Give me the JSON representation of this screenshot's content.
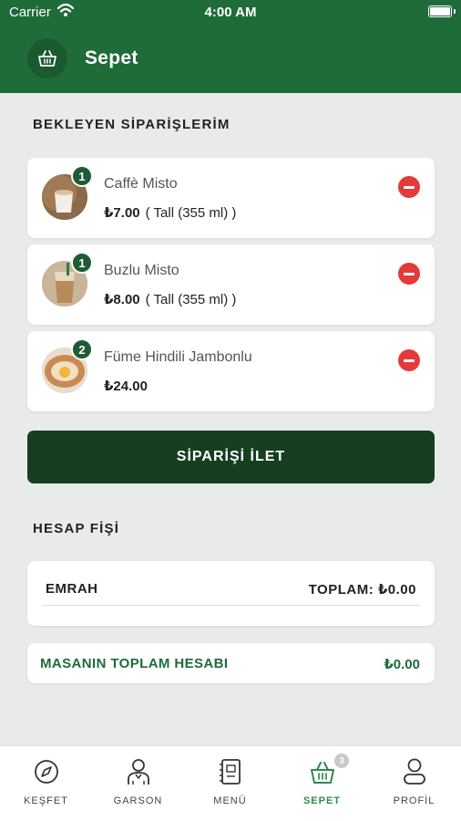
{
  "status_bar": {
    "carrier": "Carrier",
    "time": "4:00 AM"
  },
  "header": {
    "title": "Sepet",
    "icon": "basket-icon"
  },
  "pending": {
    "title": "BEKLEYEN SİPARİŞLERİM",
    "items": [
      {
        "name": "Caffè Misto",
        "price": "₺7.00",
        "size": "( Tall (355 ml) )",
        "quantity": "1",
        "image": "coffee-cup-photo"
      },
      {
        "name": "Buzlu Misto",
        "price": "₺8.00",
        "size": "( Tall (355 ml) )",
        "quantity": "1",
        "image": "iced-coffee-photo"
      },
      {
        "name": "Füme Hindili Jambonlu",
        "price": "₺24.00",
        "size": "",
        "quantity": "2",
        "image": "sandwich-photo"
      }
    ]
  },
  "submit_button": "SİPARİŞİ İLET",
  "receipt": {
    "title": "HESAP FİŞİ",
    "customer": "EMRAH",
    "total_label": "TOPLAM: ₺0.00"
  },
  "table_total": {
    "label": "MASANIN TOPLAM HESABI",
    "value": "₺0.00"
  },
  "tabs": [
    {
      "label": "KEŞFET",
      "icon": "compass-icon"
    },
    {
      "label": "GARSON",
      "icon": "waiter-icon"
    },
    {
      "label": "MENÜ",
      "icon": "menu-book-icon"
    },
    {
      "label": "SEPET",
      "icon": "basket-icon",
      "badge": "3",
      "active": true
    },
    {
      "label": "PROFİL",
      "icon": "profile-icon"
    }
  ],
  "colors": {
    "primary": "#1f6b3a",
    "dark_button": "#163f22",
    "remove": "#e53a3a",
    "active_tab": "#2f8a4f"
  }
}
